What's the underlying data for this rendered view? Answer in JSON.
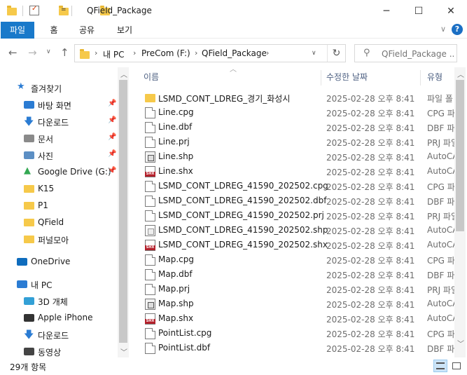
{
  "window": {
    "title": "QField_Package",
    "quick_access_dropdown": "=",
    "min": "─",
    "max": "☐",
    "close": "✕"
  },
  "ribbon": {
    "tabs": [
      "파일",
      "홈",
      "공유",
      "보기"
    ],
    "chevron": "∨",
    "help": "?"
  },
  "address": {
    "crumbs": [
      "내 PC",
      "PreCom (F:)",
      "QField_Package"
    ],
    "separator": "›",
    "dropdown": "∨",
    "refresh": "↻"
  },
  "search": {
    "placeholder": "QField_Package ...",
    "icon": "search-icon"
  },
  "navpane": {
    "items": [
      {
        "label": "즐겨찾기",
        "icon": "star-icon",
        "indent": 0,
        "pinned": false,
        "color": "#2b7cd3"
      },
      {
        "label": "바탕 화면",
        "icon": "desktop-icon",
        "indent": 1,
        "pinned": true,
        "color": "#2b7cd3"
      },
      {
        "label": "다운로드",
        "icon": "download-icon",
        "indent": 1,
        "pinned": true,
        "color": "#2b7cd3"
      },
      {
        "label": "문서",
        "icon": "documents-icon",
        "indent": 1,
        "pinned": true,
        "color": "#8a8a8a"
      },
      {
        "label": "사진",
        "icon": "pictures-icon",
        "indent": 1,
        "pinned": true,
        "color": "#5c8fc4"
      },
      {
        "label": "Google Drive (G:)",
        "icon": "google-drive-icon",
        "indent": 1,
        "pinned": true,
        "color": "#34a853"
      },
      {
        "label": "K15",
        "icon": "folder-icon",
        "indent": 1,
        "pinned": false,
        "color": "#f6c94a"
      },
      {
        "label": "P1",
        "icon": "folder-icon",
        "indent": 1,
        "pinned": false,
        "color": "#f6c94a"
      },
      {
        "label": "QField",
        "icon": "folder-icon",
        "indent": 1,
        "pinned": false,
        "color": "#f6c94a"
      },
      {
        "label": "퍼널모아",
        "icon": "folder-icon",
        "indent": 1,
        "pinned": false,
        "color": "#f6c94a"
      },
      {
        "label": "OneDrive",
        "icon": "onedrive-icon",
        "indent": 0,
        "pinned": false,
        "color": "#0f6cbd"
      },
      {
        "label": "내 PC",
        "icon": "pc-icon",
        "indent": 0,
        "pinned": false,
        "color": "#2b7cd3"
      },
      {
        "label": "3D 개체",
        "icon": "3d-objects-icon",
        "indent": 1,
        "pinned": false,
        "color": "#33a0d6"
      },
      {
        "label": "Apple iPhone",
        "icon": "iphone-icon",
        "indent": 1,
        "pinned": false,
        "color": "#333333"
      },
      {
        "label": "다운로드",
        "icon": "download-icon",
        "indent": 1,
        "pinned": false,
        "color": "#2b7cd3"
      },
      {
        "label": "동영상",
        "icon": "videos-icon",
        "indent": 1,
        "pinned": false,
        "color": "#444444"
      }
    ]
  },
  "columns": {
    "name": "이름",
    "date": "수정한 날짜",
    "type": "유형"
  },
  "files": [
    {
      "name": "LSMD_CONT_LDREG_경기_화성시",
      "date": "2025-02-28 오후 8:41",
      "type": "파일 폴",
      "icon": "folder"
    },
    {
      "name": "Line.cpg",
      "date": "2025-02-28 오후 8:41",
      "type": "CPG 파",
      "icon": "doc"
    },
    {
      "name": "Line.dbf",
      "date": "2025-02-28 오후 8:41",
      "type": "DBF 파",
      "icon": "doc"
    },
    {
      "name": "Line.prj",
      "date": "2025-02-28 오후 8:41",
      "type": "PRJ 파일",
      "icon": "doc"
    },
    {
      "name": "Line.shp",
      "date": "2025-02-28 오후 8:41",
      "type": "AutoCA",
      "icon": "shp"
    },
    {
      "name": "Line.shx",
      "date": "2025-02-28 오후 8:41",
      "type": "AutoCA",
      "icon": "shx"
    },
    {
      "name": "LSMD_CONT_LDREG_41590_202502.cpg",
      "date": "2025-02-28 오후 8:41",
      "type": "CPG 파",
      "icon": "doc"
    },
    {
      "name": "LSMD_CONT_LDREG_41590_202502.dbf",
      "date": "2025-02-28 오후 8:41",
      "type": "DBF 파",
      "icon": "doc"
    },
    {
      "name": "LSMD_CONT_LDREG_41590_202502.prj",
      "date": "2025-02-28 오후 8:41",
      "type": "PRJ 파일",
      "icon": "doc"
    },
    {
      "name": "LSMD_CONT_LDREG_41590_202502.shp",
      "date": "2025-02-28 오후 8:41",
      "type": "AutoCA",
      "icon": "shp-light"
    },
    {
      "name": "LSMD_CONT_LDREG_41590_202502.shx",
      "date": "2025-02-28 오후 8:41",
      "type": "AutoCA",
      "icon": "shx"
    },
    {
      "name": "Map.cpg",
      "date": "2025-02-28 오후 8:41",
      "type": "CPG 파",
      "icon": "doc"
    },
    {
      "name": "Map.dbf",
      "date": "2025-02-28 오후 8:41",
      "type": "DBF 파",
      "icon": "doc"
    },
    {
      "name": "Map.prj",
      "date": "2025-02-28 오후 8:41",
      "type": "PRJ 파일",
      "icon": "doc"
    },
    {
      "name": "Map.shp",
      "date": "2025-02-28 오후 8:41",
      "type": "AutoCA",
      "icon": "shp"
    },
    {
      "name": "Map.shx",
      "date": "2025-02-28 오후 8:41",
      "type": "AutoCA",
      "icon": "shx"
    },
    {
      "name": "PointList.cpg",
      "date": "2025-02-28 오후 8:41",
      "type": "CPG 파",
      "icon": "doc"
    },
    {
      "name": "PointList.dbf",
      "date": "2025-02-28 오후 8:41",
      "type": "DBF 파",
      "icon": "doc"
    }
  ],
  "status": {
    "count": "29개 항목"
  }
}
